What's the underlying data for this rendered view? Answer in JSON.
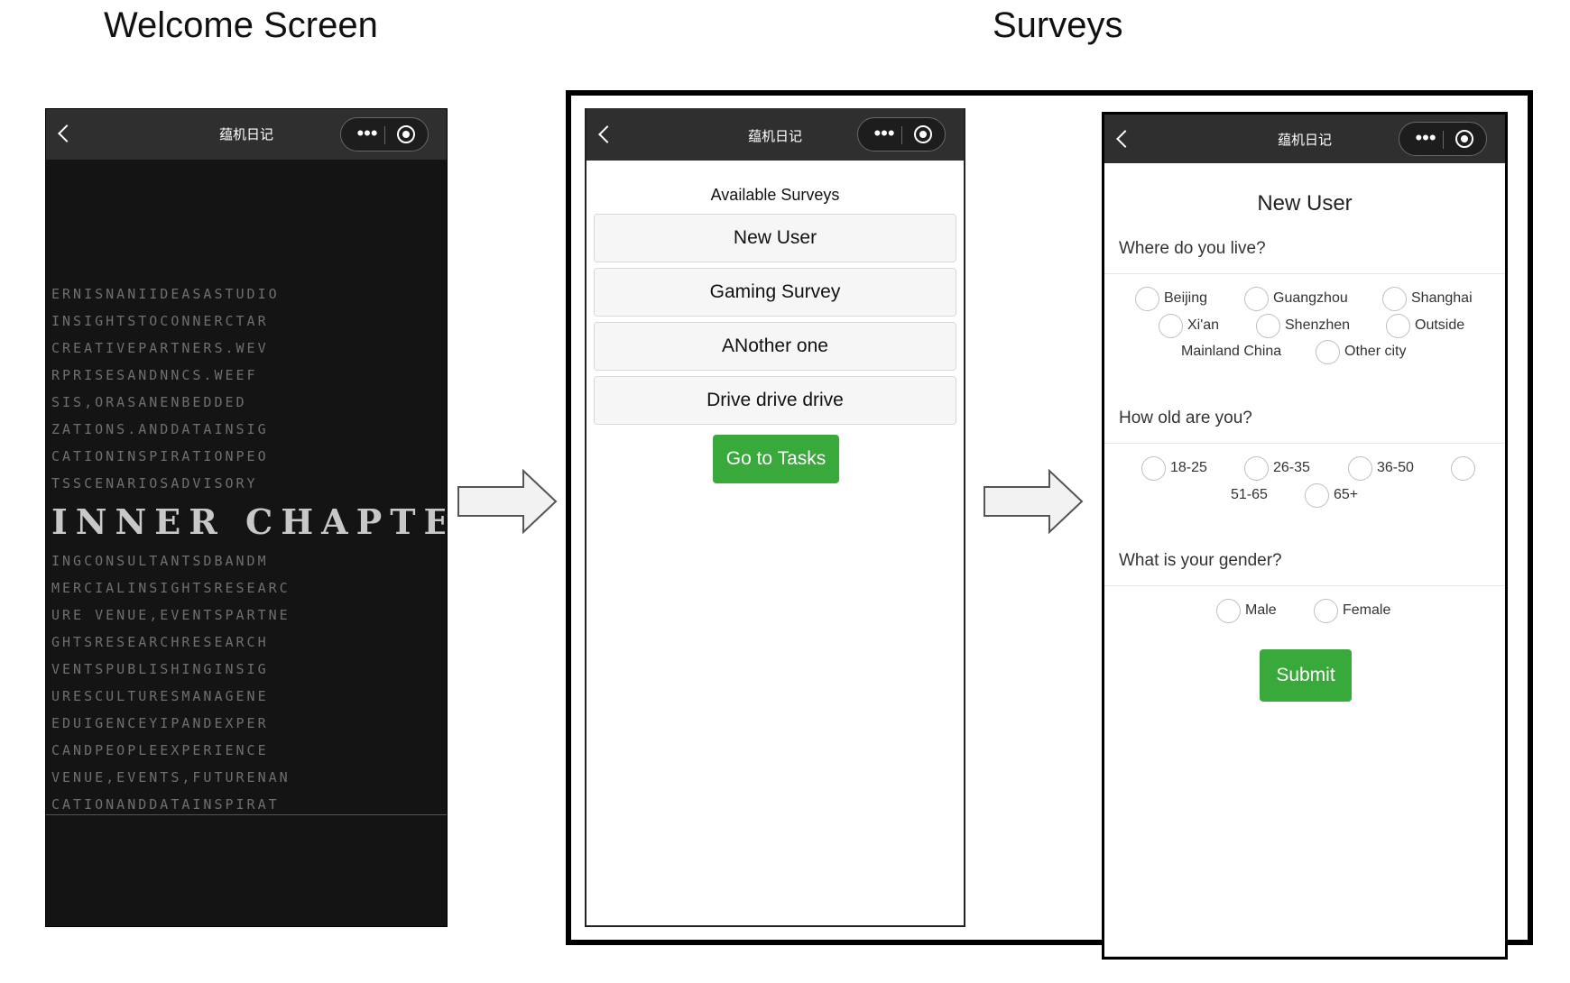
{
  "labels": {
    "welcome": "Welcome Screen",
    "surveys": "Surveys"
  },
  "miniapp": {
    "title": "蕴机日记",
    "more_icon": "•••"
  },
  "splash": {
    "lines": [
      "ERNISNANIIDEASASTUDIO",
      "INSIGHTSTOCONNERCTAR",
      "CREATIVEPARTNERS.WEV",
      "RPRISESANDNNCS.WEEF",
      "SIS,ORASANENBEDDED",
      "ZATIONS.ANDDATAINSIG",
      "CATIONINSPIRATIONPEO",
      "TSSCENARIOSADVISORY"
    ],
    "logo": "INNER CHAPTER",
    "lines_after": [
      "INGCONSULTANTSDBANDM",
      "MERCIALINSIGHTSRESEARC",
      "URE VENUE,EVENTSPARTNE",
      "GHTSRESEARCHRESEARCH",
      "VENTSPUBLISHINGINSIG",
      "URESCULTURESMANAGENE",
      "EDUIGENCEYIPANDEXPER",
      "CANDPEOPLEEXPERIENCE",
      "VENUE,EVENTS,FUTURENAN",
      "CATIONANDDATAINSPIRAT"
    ]
  },
  "survey_list": {
    "heading": "Available Surveys",
    "items": [
      "New User",
      "Gaming Survey",
      "ANother one",
      "Drive drive drive"
    ],
    "button": "Go to Tasks"
  },
  "survey_form": {
    "title": "New User",
    "q1": {
      "label": "Where do you live?",
      "options": [
        "Beijing",
        "Guangzhou",
        "Shanghai",
        "Xi'an",
        "Shenzhen",
        "Outside",
        "Mainland China",
        "Other city"
      ]
    },
    "q2": {
      "label": "How old are you?",
      "options": [
        "18-25",
        "26-35",
        "36-50",
        "51-65",
        "65+"
      ]
    },
    "q3": {
      "label": "What is your gender?",
      "options": [
        "Male",
        "Female"
      ]
    },
    "submit": "Submit"
  },
  "colors": {
    "green": "#3aa93c",
    "nav_bar": "#2f2f2f",
    "splash_bg": "#141414"
  }
}
